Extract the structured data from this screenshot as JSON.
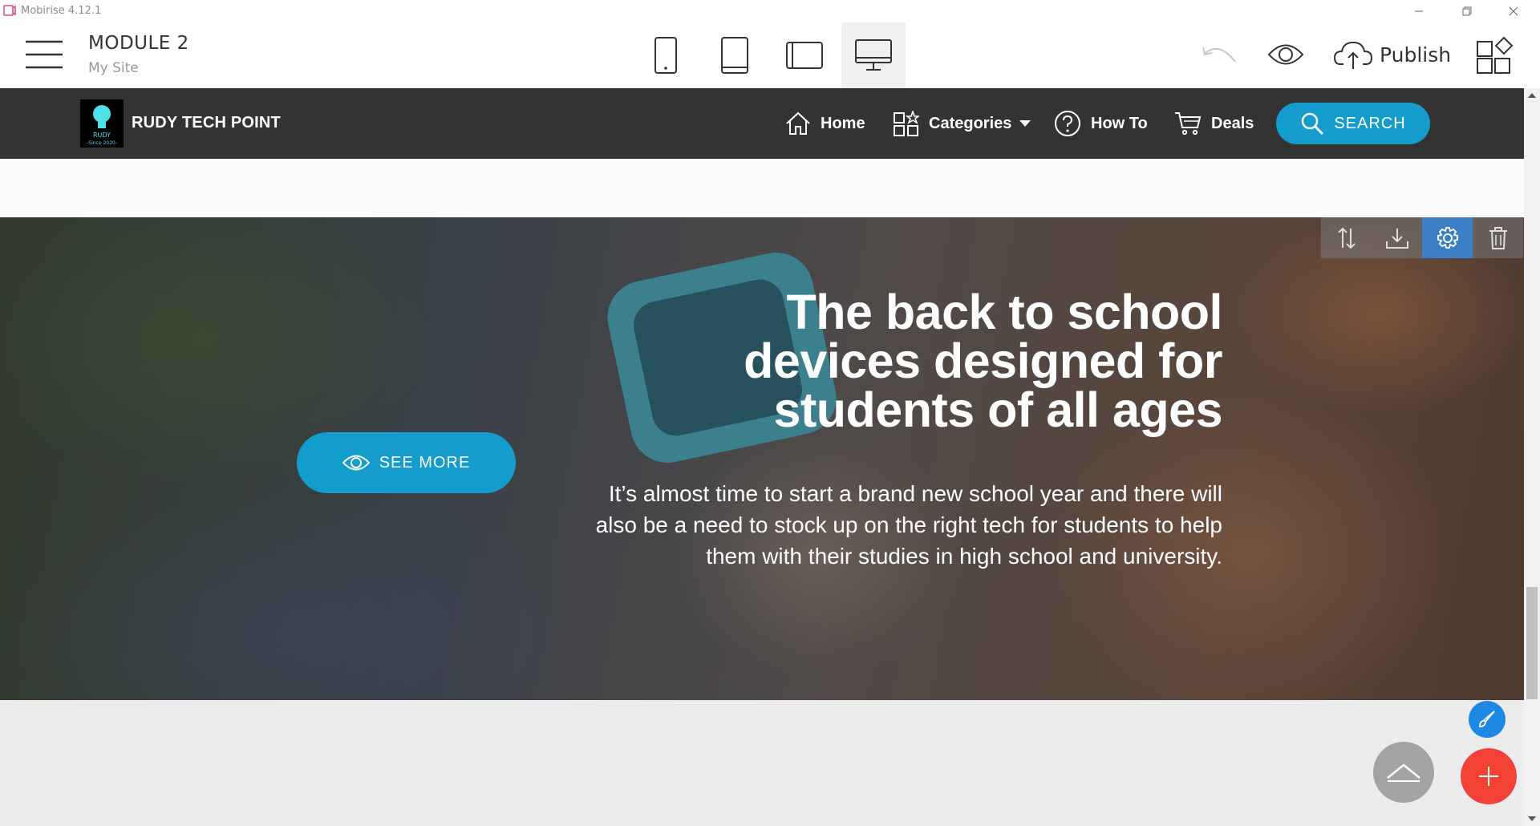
{
  "window": {
    "title": "Mobirise 4.12.1"
  },
  "toolbar": {
    "project_name": "MODULE 2",
    "site_name": "My Site",
    "publish_label": "Publish",
    "devices": [
      "phone-icon",
      "tablet-icon",
      "tablet-landscape-icon",
      "desktop-icon"
    ],
    "active_device": "desktop-icon"
  },
  "site": {
    "brand": "RUDY TECH POINT",
    "logo_lines": [
      "RUDY",
      "-Since 2020-"
    ],
    "nav": [
      {
        "label": "Home",
        "icon": "home-icon"
      },
      {
        "label": "Categories",
        "icon": "categories-icon"
      },
      {
        "label": "How To",
        "icon": "help-circle-icon"
      },
      {
        "label": "Deals",
        "icon": "cart-icon"
      }
    ],
    "search_label": "SEARCH"
  },
  "hero": {
    "title": "The back to school devices designed for students of all ages",
    "text": "It’s almost time to start a brand new school year and there will also be a need to stock up on the right tech for students to help them with their studies in high school and university.",
    "button_label": "SEE MORE"
  },
  "colors": {
    "accent": "#149dcc",
    "nav_bg": "#333333",
    "fab_add": "#f44336",
    "fab_brush": "#1e88e5",
    "section_tool_active": "#3b7fc4"
  }
}
